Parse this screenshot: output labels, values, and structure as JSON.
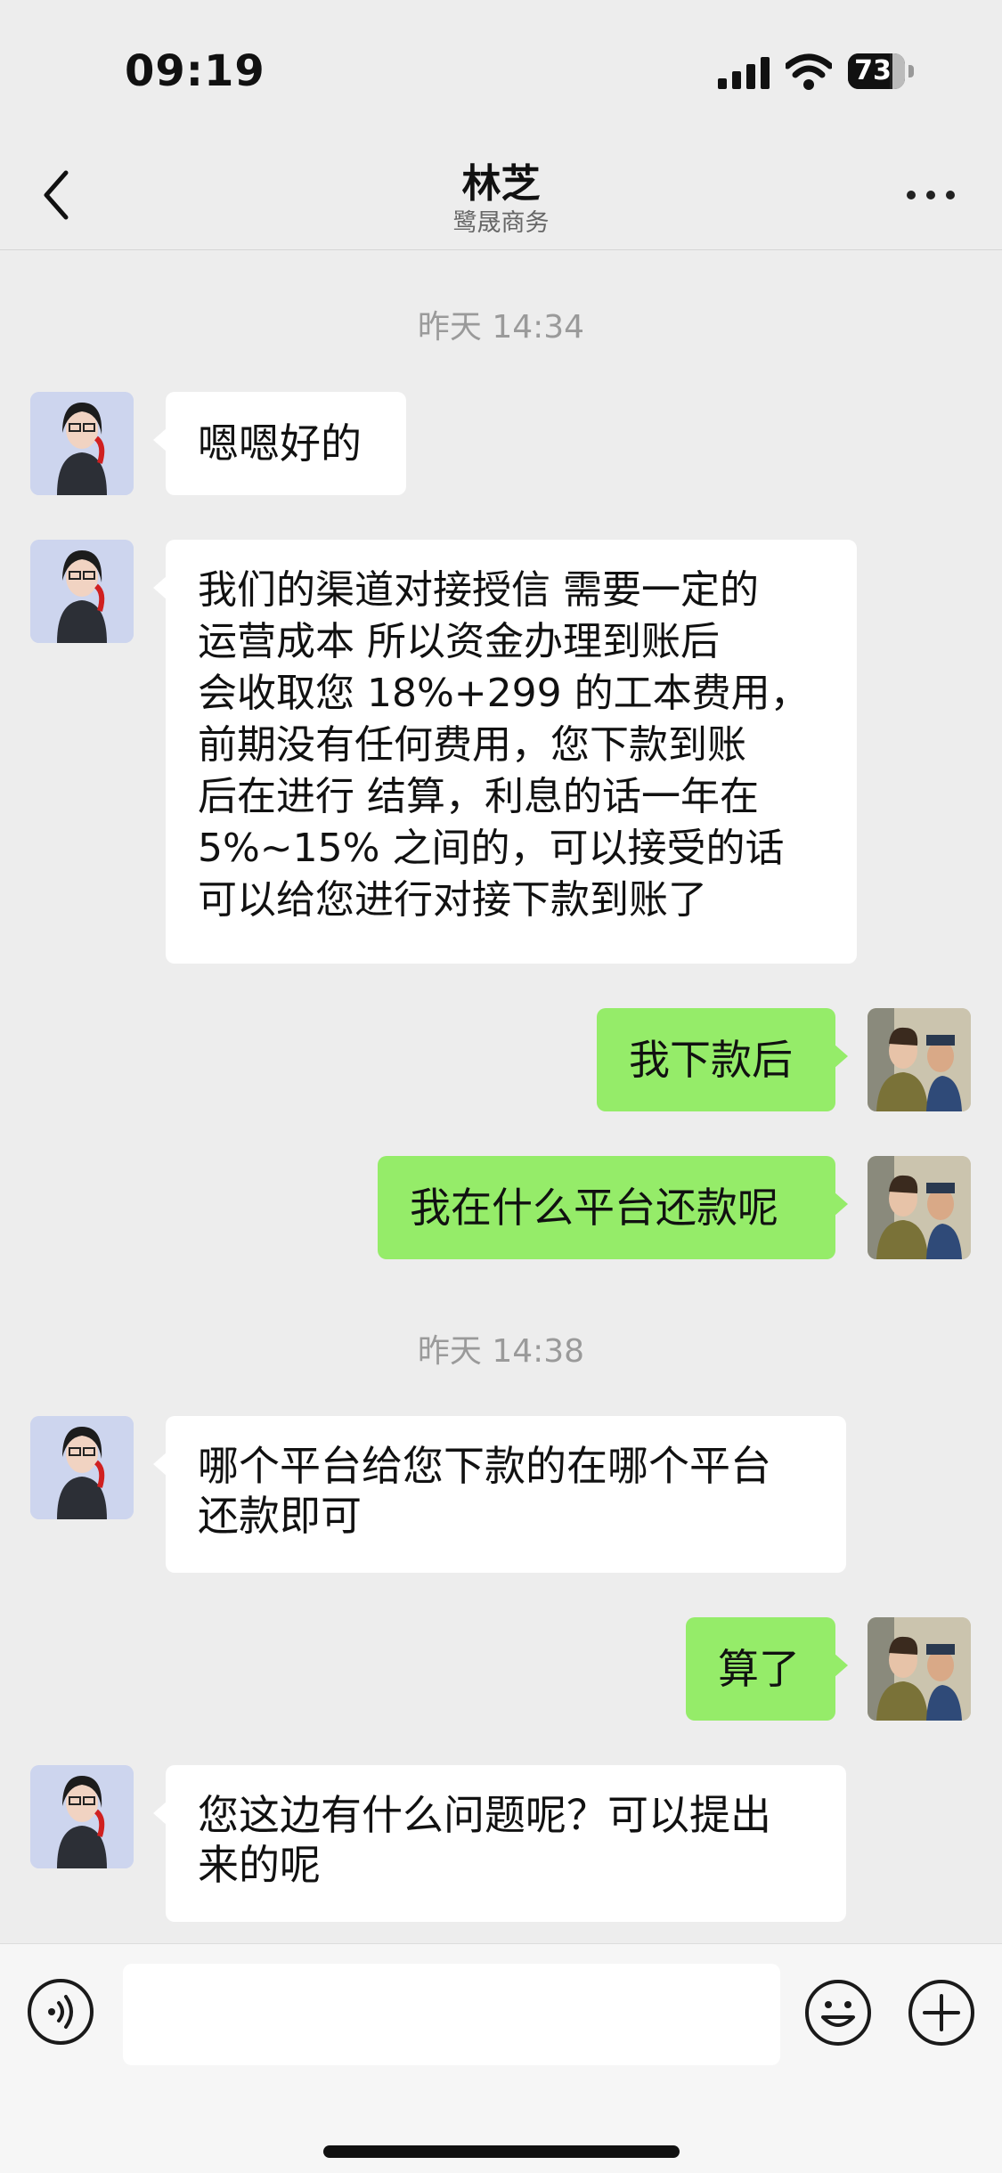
{
  "status_bar": {
    "time": "09:19",
    "battery": "73",
    "battery_level_percent": 73
  },
  "nav": {
    "title": "林芝",
    "subtitle": "鹭晟商务",
    "back_icon": "chevron-left-icon",
    "more_icon": "more-dots-icon"
  },
  "timestamps": [
    "昨天 14:34",
    "昨天 14:38"
  ],
  "messages": [
    {
      "from": "contact",
      "lines": [
        "嗯嗯好的"
      ]
    },
    {
      "from": "contact",
      "lines": [
        "我们的渠道对接授信 需要一定的",
        "运营成本 所以资金办理到账后",
        "会收取您 18%+299 的工本费用，",
        "前期没有任何费用，您下款到账",
        "后在进行 结算，利息的话一年在",
        "5%~15% 之间的，可以接受的话",
        "可以给您进行对接下款到账了"
      ]
    },
    {
      "from": "me",
      "lines": [
        "我下款后"
      ]
    },
    {
      "from": "me",
      "lines": [
        "我在什么平台还款呢"
      ]
    },
    {
      "from": "contact",
      "lines": [
        "哪个平台给您下款的在哪个平台",
        "还款即可"
      ]
    },
    {
      "from": "me",
      "lines": [
        "算了"
      ]
    },
    {
      "from": "contact",
      "lines": [
        "您这边有什么问题呢？可以提出",
        "来的呢"
      ]
    }
  ],
  "input_bar": {
    "value": "",
    "icons": [
      "voice-icon",
      "emoji-icon",
      "plus-icon"
    ]
  },
  "colors": {
    "outgoing_bubble": "#95ec69",
    "incoming_bubble": "#ffffff",
    "background": "#ededed"
  }
}
